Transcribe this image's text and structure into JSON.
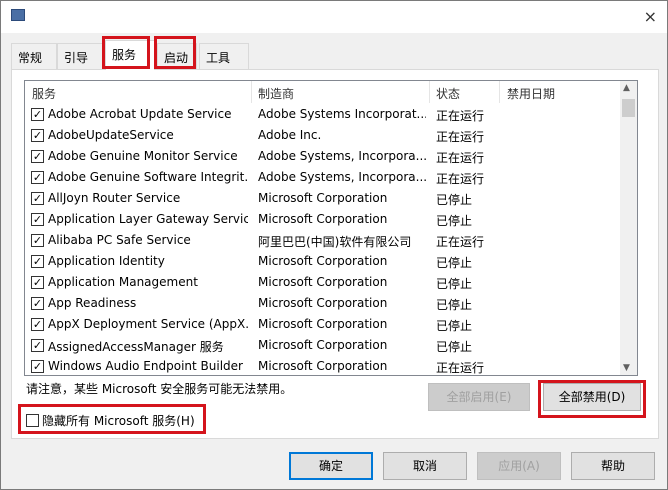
{
  "window": {
    "close_icon": "×"
  },
  "tabs": [
    {
      "label": "常规"
    },
    {
      "label": "引导"
    },
    {
      "label": "服务",
      "active": true
    },
    {
      "label": "启动"
    },
    {
      "label": "工具"
    }
  ],
  "columns": {
    "service": "服务",
    "vendor": "制造商",
    "status": "状态",
    "disabled_date": "禁用日期"
  },
  "rows": [
    {
      "name": "Adobe Acrobat Update Service",
      "vendor": "Adobe Systems Incorporat...",
      "status": "正在运行",
      "checked": true
    },
    {
      "name": "AdobeUpdateService",
      "vendor": "Adobe Inc.",
      "status": "正在运行",
      "checked": true
    },
    {
      "name": "Adobe Genuine Monitor Service",
      "vendor": "Adobe Systems, Incorpora...",
      "status": "正在运行",
      "checked": true
    },
    {
      "name": "Adobe Genuine Software Integrit...",
      "vendor": "Adobe Systems, Incorpora...",
      "status": "正在运行",
      "checked": true
    },
    {
      "name": "AllJoyn Router Service",
      "vendor": "Microsoft Corporation",
      "status": "已停止",
      "checked": true
    },
    {
      "name": "Application Layer Gateway Service",
      "vendor": "Microsoft Corporation",
      "status": "已停止",
      "checked": true
    },
    {
      "name": "Alibaba PC Safe Service",
      "vendor": "阿里巴巴(中国)软件有限公司",
      "status": "正在运行",
      "checked": true
    },
    {
      "name": "Application Identity",
      "vendor": "Microsoft Corporation",
      "status": "已停止",
      "checked": true
    },
    {
      "name": "Application Management",
      "vendor": "Microsoft Corporation",
      "status": "已停止",
      "checked": true
    },
    {
      "name": "App Readiness",
      "vendor": "Microsoft Corporation",
      "status": "已停止",
      "checked": true
    },
    {
      "name": "AppX Deployment Service (AppX...",
      "vendor": "Microsoft Corporation",
      "status": "已停止",
      "checked": true
    },
    {
      "name": "AssignedAccessManager 服务",
      "vendor": "Microsoft Corporation",
      "status": "已停止",
      "checked": true
    },
    {
      "name": "Windows Audio Endpoint Builder",
      "vendor": "Microsoft Corporation",
      "status": "正在运行",
      "checked": true
    }
  ],
  "note": "请注意，某些 Microsoft 安全服务可能无法禁用。",
  "enable_all": "全部启用(E)",
  "disable_all": "全部禁用(D)",
  "hide_ms": "隐藏所有 Microsoft 服务(H)",
  "buttons": {
    "ok": "确定",
    "cancel": "取消",
    "apply": "应用(A)",
    "help": "帮助"
  },
  "highlight_color": "#d4141c"
}
